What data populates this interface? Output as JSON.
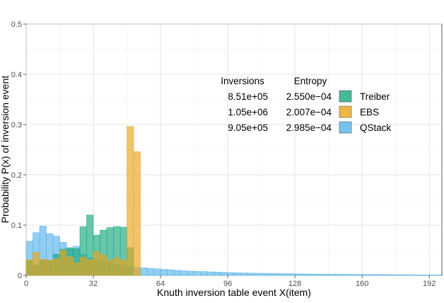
{
  "chart_data": {
    "type": "bar",
    "subtype": "overlaid histogram",
    "xlabel": "Knuth inversion table event X(item)",
    "ylabel": "Probability P(x) of inversion event",
    "xlim": [
      0,
      198
    ],
    "ylim": [
      0,
      0.5
    ],
    "bin_width": 3.2,
    "x_ticks": [
      0,
      32,
      64,
      96,
      128,
      160,
      192
    ],
    "y_ticks": [
      0,
      0.1,
      0.2,
      0.3,
      0.4,
      0.5
    ],
    "y_tick_labels": [
      "0",
      "0.1",
      "0.2",
      "0.3",
      "0.4",
      "0.5"
    ],
    "grid": true,
    "legend": {
      "position": "top-right",
      "header_inversions": "Inversions",
      "header_entropy": "Entropy"
    },
    "series": [
      {
        "name": "Treiber",
        "color": "#17a77e",
        "inversions": "8.51e+05",
        "entropy": "2.550e−04",
        "values": [
          0.03,
          0.02,
          0.03,
          0.03,
          0.042,
          0.052,
          0.055,
          0.053,
          0.097,
          0.12,
          0.08,
          0.09,
          0.095,
          0.097,
          0.096,
          0.055,
          0.0
        ]
      },
      {
        "name": "EBS",
        "color": "#e8a419",
        "inversions": "1.05e+06",
        "entropy": "2.007e−04",
        "values": [
          0.031,
          0.046,
          0.032,
          0.03,
          0.033,
          0.05,
          0.037,
          0.025,
          0.036,
          0.031,
          0.047,
          0.04,
          0.03,
          0.035,
          0.03,
          0.296,
          0.246
        ]
      },
      {
        "name": "QStack",
        "color": "#56b4e9",
        "inversions": "9.05e+05",
        "entropy": "2.985e−04",
        "values": [
          0.068,
          0.085,
          0.098,
          0.083,
          0.078,
          0.066,
          0.053,
          0.058,
          0.042,
          0.035,
          0.032,
          0.028,
          0.025,
          0.022,
          0.02,
          0.018,
          0.016,
          0.015,
          0.014,
          0.013,
          0.012,
          0.011,
          0.01,
          0.009,
          0.0085,
          0.008,
          0.0075,
          0.007,
          0.0065,
          0.006,
          0.0055,
          0.005,
          0.0048,
          0.0045,
          0.0042,
          0.004,
          0.0038,
          0.0036,
          0.0034,
          0.0032,
          0.003,
          0.0028,
          0.0026,
          0.0025,
          0.0024,
          0.0023,
          0.0022,
          0.0021,
          0.002,
          0.0019,
          0.0018,
          0.0017,
          0.0016,
          0.0015,
          0.0014,
          0.0013,
          0.0012,
          0.0011,
          0.001,
          0.001,
          0.0009,
          0.0008
        ]
      }
    ]
  }
}
